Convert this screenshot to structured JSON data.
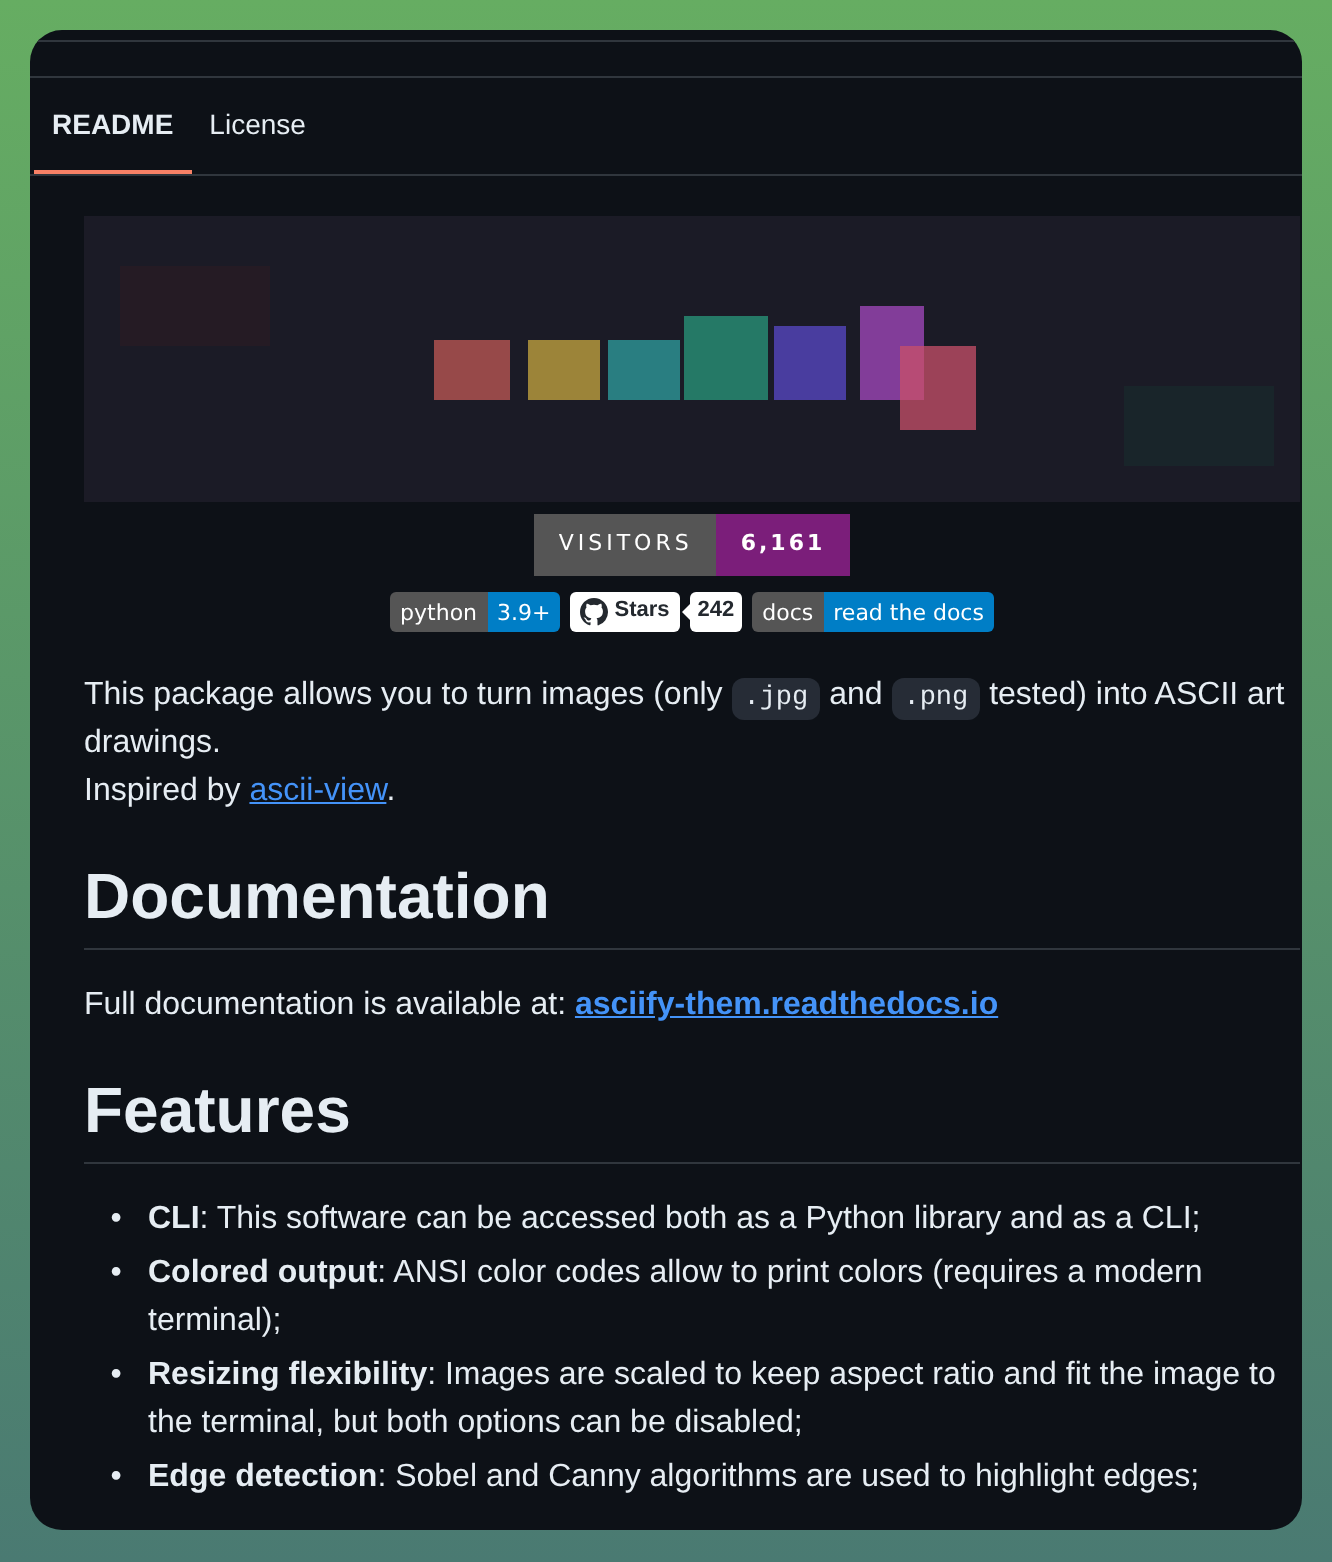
{
  "tabs": [
    {
      "label": "README",
      "selected": true
    },
    {
      "label": "License",
      "selected": false
    }
  ],
  "visitors": {
    "label": "VISITORS",
    "value": "6,161"
  },
  "badges": [
    {
      "kind": "shield",
      "label": "python",
      "value": "3.9+"
    },
    {
      "kind": "github",
      "label": "Stars",
      "value": "242"
    },
    {
      "kind": "shield",
      "label": "docs",
      "value": "read the docs"
    }
  ],
  "intro": [
    {
      "kind": "text",
      "text": "This package allows you to turn images (only "
    },
    {
      "kind": "code",
      "text": ".jpg"
    },
    {
      "kind": "text",
      "text": " and "
    },
    {
      "kind": "code",
      "text": ".png"
    },
    {
      "kind": "text",
      "text": " tested) into ASCII art drawings."
    },
    {
      "kind": "break"
    },
    {
      "kind": "text",
      "text": "Inspired by "
    },
    {
      "kind": "link",
      "text": "ascii-view"
    },
    {
      "kind": "text",
      "text": "."
    }
  ],
  "sections": [
    {
      "heading": "Documentation",
      "body": [
        {
          "kind": "text",
          "text": "Full documentation is available at: "
        },
        {
          "kind": "link",
          "text": "asciify-them.readthedocs.io",
          "bold": true
        }
      ]
    },
    {
      "heading": "Features",
      "items": [
        {
          "marker": "•",
          "text": "**CLI**: This software can be accessed both as a Python library and as a CLI;"
        },
        {
          "marker": "•",
          "text": "**Colored output**: ANSI color codes allow to print colors (requires a modern terminal);"
        },
        {
          "marker": "•",
          "text": "**Resizing flexibility**: Images are scaled to keep aspect ratio and fit the image to the terminal, but both options can be disabled;"
        },
        {
          "marker": "•",
          "text": "**Edge detection**: Sobel and Canny algorithms are used to highlight edges;"
        }
      ]
    }
  ]
}
